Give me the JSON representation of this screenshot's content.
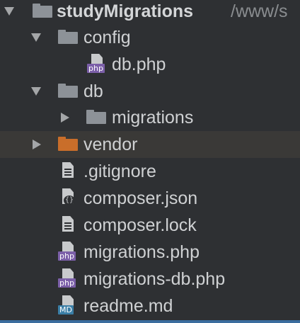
{
  "project": {
    "name": "studyMigrations",
    "path": "/www/s"
  },
  "items": [
    {
      "label": "config",
      "kind": "folder",
      "expanded": true
    },
    {
      "label": "db.php",
      "kind": "file-php",
      "badge": "php"
    },
    {
      "label": "db",
      "kind": "folder",
      "expanded": true
    },
    {
      "label": "migrations",
      "kind": "folder",
      "expanded": false
    },
    {
      "label": "vendor",
      "kind": "folder-excluded",
      "expanded": false,
      "selected": true
    },
    {
      "label": ".gitignore",
      "kind": "file-text"
    },
    {
      "label": "composer.json",
      "kind": "file-json"
    },
    {
      "label": "composer.lock",
      "kind": "file-text"
    },
    {
      "label": "migrations.php",
      "kind": "file-php",
      "badge": "php"
    },
    {
      "label": "migrations-db.php",
      "kind": "file-php",
      "badge": "php"
    },
    {
      "label": "readme.md",
      "kind": "file-md",
      "badge": "MD"
    }
  ],
  "colors": {
    "background": "#2e3033",
    "text": "#cfd1d3",
    "folder": "#8d9298",
    "excluded_folder": "#c96e2a",
    "php_badge": "#7b5fa8",
    "md_badge": "#3a7ea6"
  }
}
